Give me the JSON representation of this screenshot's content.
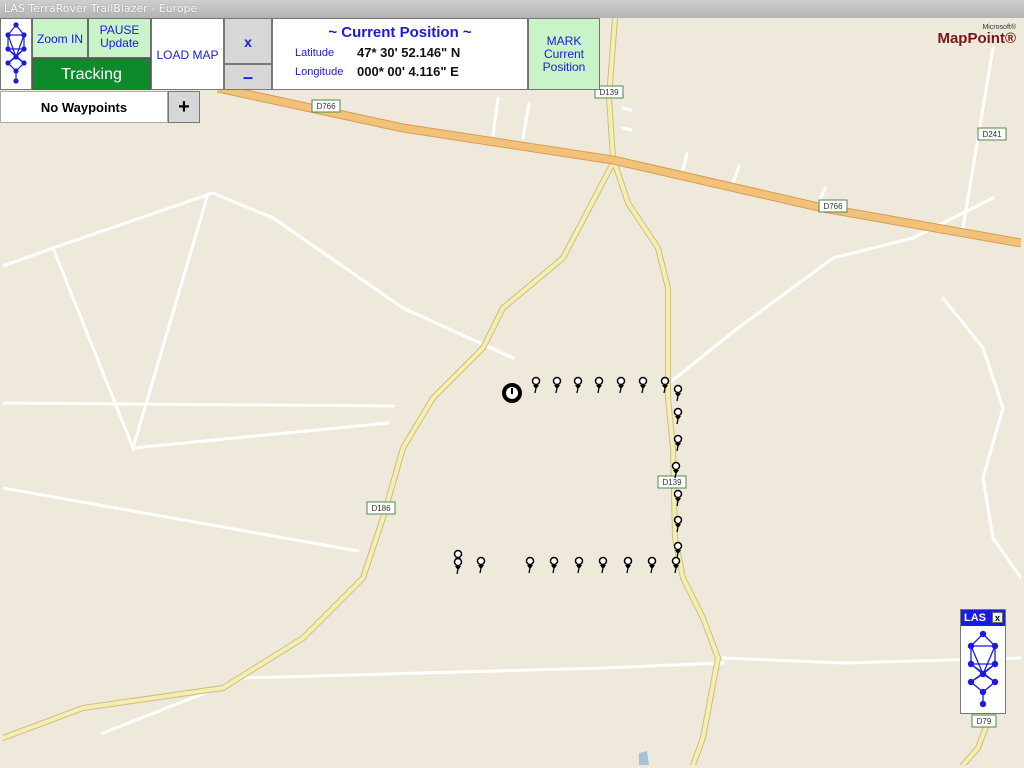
{
  "window": {
    "title": "LAS TerraRover TrailBlazer - Europe"
  },
  "toolbar": {
    "zoom_in": "Zoom IN",
    "pause_line1": "PAUSE",
    "pause_line2": "Update",
    "tracking": "Tracking",
    "load_map": "LOAD MAP",
    "zoom_x": "x",
    "zoom_minus": "–",
    "mark_line1": "MARK",
    "mark_line2": "Current",
    "mark_line3": "Position"
  },
  "position": {
    "title": "~ Current Position ~",
    "latitude_label": "Latitude",
    "latitude_value": "47* 30' 52.146\" N",
    "longitude_label": "Longitude",
    "longitude_value": "000* 00' 4.116\" E"
  },
  "waypoints": {
    "label": "No Waypoints",
    "add": "+"
  },
  "branding": {
    "microsoft": "Microsoft®",
    "mappoint": "MapPoint®"
  },
  "las_mini": {
    "label": "LAS",
    "close": "x"
  },
  "map": {
    "road_labels": [
      "D766",
      "D139",
      "D241",
      "D766",
      "D139",
      "D186",
      "D79"
    ]
  },
  "colors": {
    "accent": "#1a1ae0",
    "button_green": "#c9f3c9",
    "tracking_green": "#0d8a2c",
    "highway": "#f3c27a",
    "road": "#f6eeb0",
    "map_bg": "#efe9dc"
  }
}
